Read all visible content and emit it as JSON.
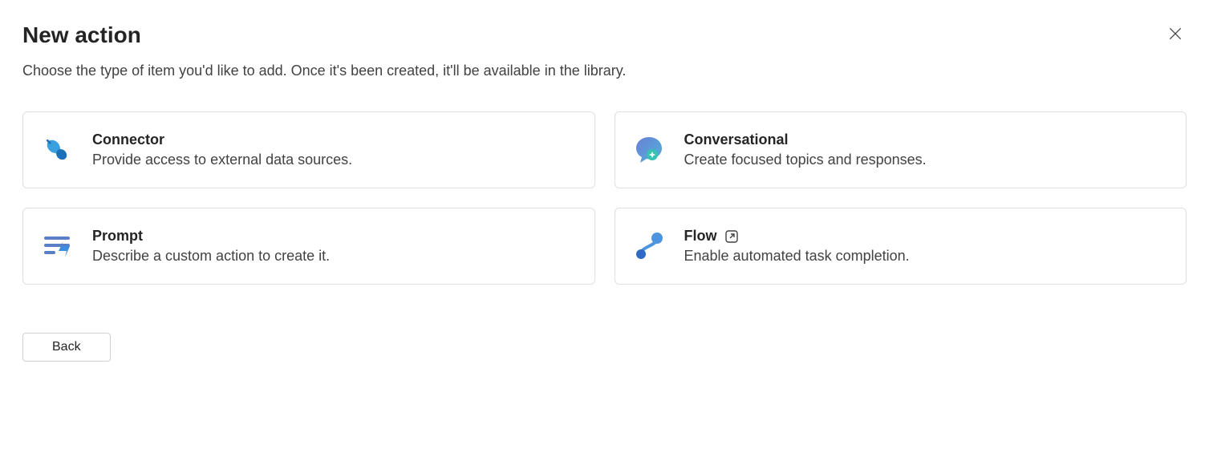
{
  "header": {
    "title": "New action",
    "subtitle": "Choose the type of item you'd like to add. Once it's been created, it'll be available in the library."
  },
  "cards": {
    "connector": {
      "title": "Connector",
      "desc": "Provide access to external data sources."
    },
    "conversational": {
      "title": "Conversational",
      "desc": "Create focused topics and responses."
    },
    "prompt": {
      "title": "Prompt",
      "desc": "Describe a custom action to create it."
    },
    "flow": {
      "title": "Flow",
      "desc": "Enable automated task completion."
    }
  },
  "footer": {
    "back_label": "Back"
  }
}
